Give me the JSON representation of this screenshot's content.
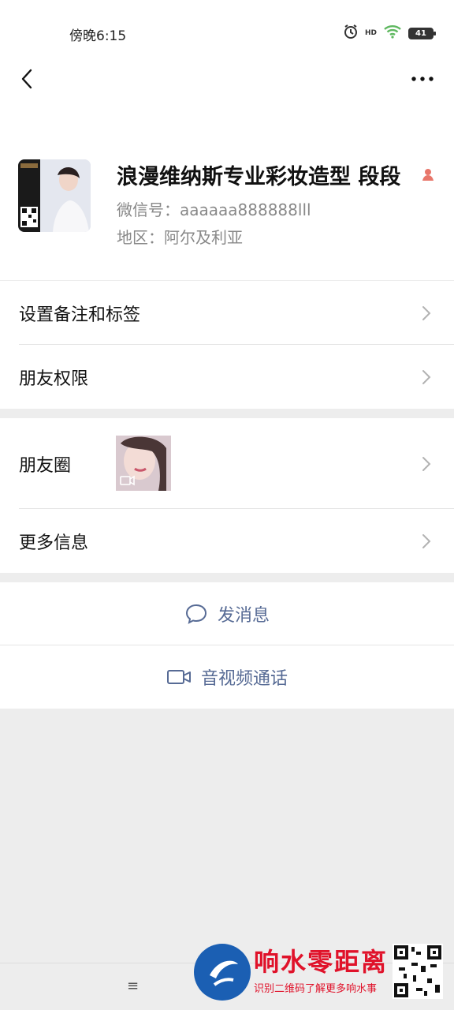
{
  "status_bar": {
    "time": "傍晚6:15",
    "battery": "41",
    "hd_label": "HD"
  },
  "nav": {
    "back_icon": "chevron-left-icon",
    "more_icon": "more-dots-icon"
  },
  "profile": {
    "nickname": "浪漫维纳斯专业彩妆造型 段段",
    "wechat_id": "微信号：aaaaaa888888lll",
    "region": "地区：阿尔及利亚"
  },
  "settings": {
    "remark_tags": "设置备注和标签",
    "friend_permissions": "朋友权限"
  },
  "info": {
    "moments": "朋友圈",
    "more_info": "更多信息"
  },
  "actions": {
    "send_message": "发消息",
    "video_call": "音视频通话"
  },
  "bottom": {
    "menu_icon": "≡"
  },
  "watermark": {
    "title": "响水零距离",
    "subtitle": "识别二维码了解更多响水事"
  },
  "colors": {
    "accent": "#576b95",
    "watermark_red": "#e0122a",
    "gender_badge": "#e8766a"
  }
}
